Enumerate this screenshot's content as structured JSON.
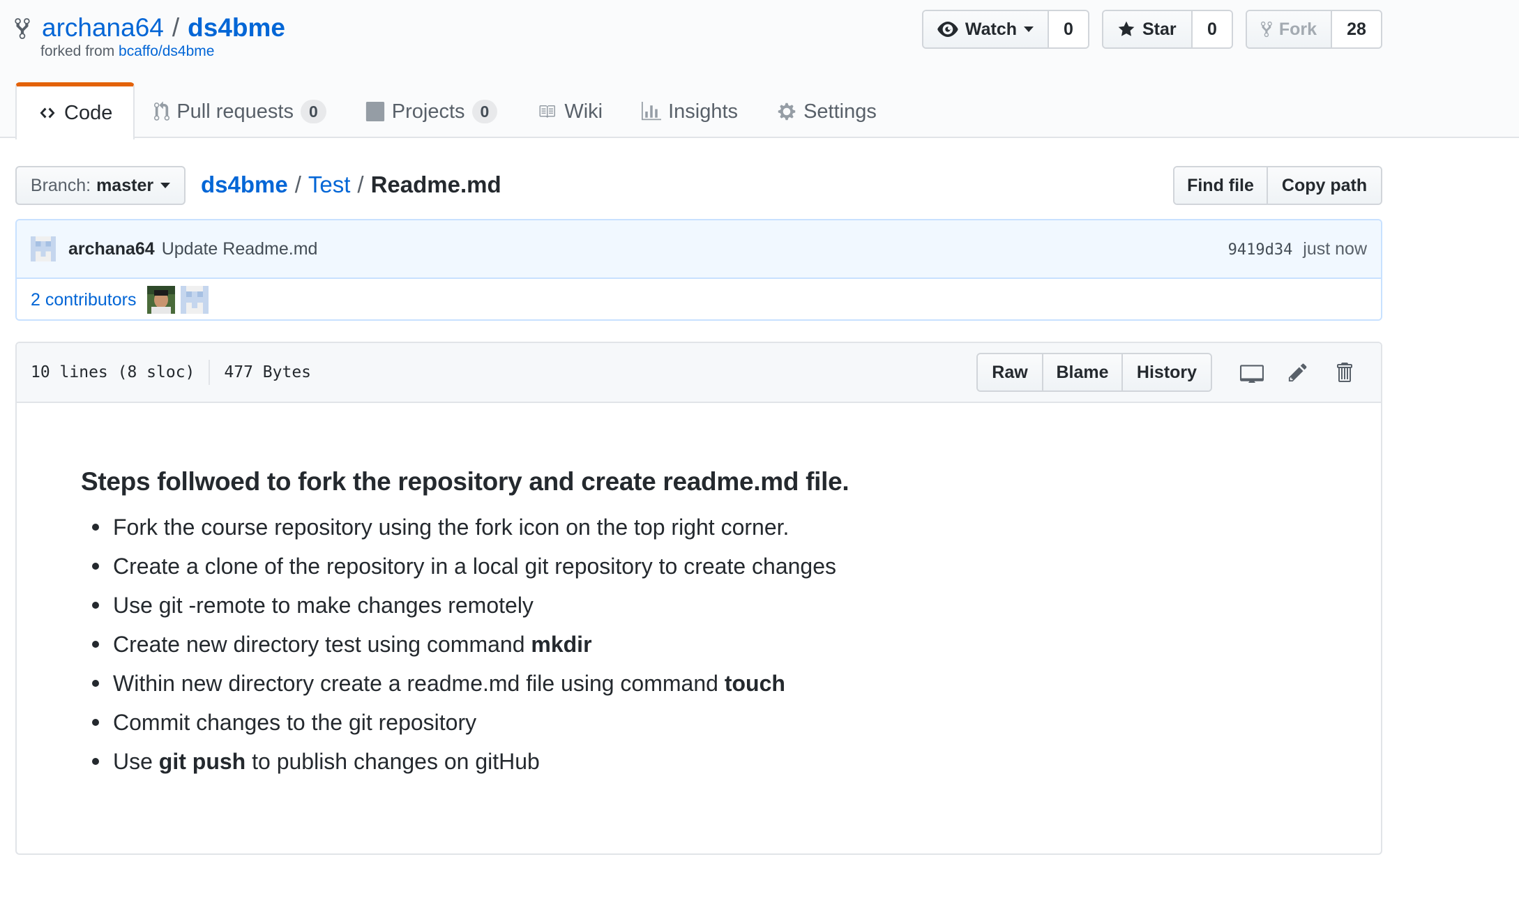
{
  "repo": {
    "owner": "archana64",
    "separator": "/",
    "name": "ds4bme",
    "forked_prefix": "forked from",
    "forked_source": "bcaffo/ds4bme"
  },
  "actions": {
    "watch_label": "Watch",
    "watch_count": "0",
    "star_label": "Star",
    "star_count": "0",
    "fork_label": "Fork",
    "fork_count": "28"
  },
  "tabs": [
    {
      "label": "Code",
      "icon": "code-icon",
      "selected": true
    },
    {
      "label": "Pull requests",
      "icon": "pull-request-icon",
      "counter": "0"
    },
    {
      "label": "Projects",
      "icon": "project-icon",
      "counter": "0"
    },
    {
      "label": "Wiki",
      "icon": "book-icon"
    },
    {
      "label": "Insights",
      "icon": "graph-icon"
    },
    {
      "label": "Settings",
      "icon": "gear-icon"
    }
  ],
  "file_nav": {
    "branch_prefix": "Branch:",
    "branch_name": "master",
    "breadcrumb": [
      "ds4bme",
      "Test",
      "Readme.md"
    ],
    "separator": "/",
    "find_file": "Find file",
    "copy_path": "Copy path"
  },
  "commit": {
    "author": "archana64",
    "message": "Update Readme.md",
    "sha": "9419d34",
    "time": "just now",
    "contributors": "2 contributors"
  },
  "file": {
    "lines": "10 lines (8 sloc)",
    "size": "477 Bytes",
    "raw": "Raw",
    "blame": "Blame",
    "history": "History",
    "icons": [
      "desktop-icon",
      "pencil-icon",
      "trashcan-icon"
    ]
  },
  "readme": {
    "heading": "Steps follwoed to fork the repository and create readme.md file.",
    "items": [
      {
        "text": "Fork the course repository using the fork icon on the top right corner.",
        "bold": ""
      },
      {
        "text": "Create a clone of the repository in a local git repository to create changes",
        "bold": ""
      },
      {
        "text": "Use git -remote to make changes remotely",
        "bold": ""
      },
      {
        "text": "Create new directory test using command ",
        "bold": "mkdir"
      },
      {
        "text": "Within new directory create a readme.md file using command ",
        "bold": "touch"
      },
      {
        "text": "Commit changes to the git repository",
        "bold": ""
      },
      {
        "pre": "Use ",
        "bold": "git push",
        "text": " to publish changes on gitHub"
      }
    ]
  },
  "colors": {
    "link": "#0366d6",
    "tab_accent": "#e36209",
    "commit_bg": "#f1f8ff"
  }
}
